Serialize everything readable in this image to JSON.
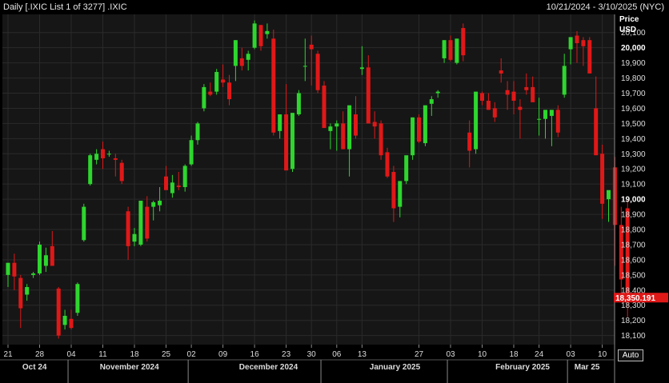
{
  "header": {
    "title": "Daily [.IXIC List 1 of 3277] .IXIC",
    "range": "10/21/2024 - 3/10/2025 (NYC)"
  },
  "auto_label": "Auto",
  "colors": {
    "up": "#2ed62e",
    "down": "#e01818",
    "grid": "#2a2a2a",
    "panel": "#161616",
    "last_bg": "#e01818"
  },
  "chart_data": {
    "type": "candlestick",
    "ylabel": "Price",
    "yunit": "USD",
    "ylim": [
      18040,
      20220
    ],
    "yticks": [
      18100,
      18200,
      18300,
      18400,
      18500,
      18600,
      18700,
      18800,
      18900,
      19000,
      19100,
      19200,
      19300,
      19400,
      19500,
      19600,
      19700,
      19800,
      19900,
      20000,
      20100
    ],
    "ytick_labels": [
      "18,100",
      "18,200",
      "18,300",
      "18,400",
      "18,500",
      "18,600",
      "18,700",
      "18,800",
      "18,900",
      "19,000",
      "19,100",
      "19,200",
      "19,300",
      "19,400",
      "19,500",
      "19,600",
      "19,700",
      "19,800",
      "19,900",
      "20,000",
      "20,100"
    ],
    "major_yticks": [
      19000,
      20000
    ],
    "last_price": 18350.191,
    "last_price_label": "18,350.191",
    "xticks": [
      {
        "idx": 0,
        "label": "21"
      },
      {
        "idx": 5,
        "label": "28"
      },
      {
        "idx": 10,
        "label": "04"
      },
      {
        "idx": 15,
        "label": "11"
      },
      {
        "idx": 20,
        "label": "18"
      },
      {
        "idx": 25,
        "label": "25"
      },
      {
        "idx": 29,
        "label": "02"
      },
      {
        "idx": 34,
        "label": "09"
      },
      {
        "idx": 39,
        "label": "16"
      },
      {
        "idx": 44,
        "label": "23"
      },
      {
        "idx": 48,
        "label": "30"
      },
      {
        "idx": 52,
        "label": "06"
      },
      {
        "idx": 56,
        "label": "13"
      },
      {
        "idx": 65,
        "label": "27"
      },
      {
        "idx": 70,
        "label": "03"
      },
      {
        "idx": 75,
        "label": "10"
      },
      {
        "idx": 80,
        "label": "18"
      },
      {
        "idx": 84,
        "label": "24"
      },
      {
        "idx": 89,
        "label": "03"
      },
      {
        "idx": 94,
        "label": "10"
      }
    ],
    "months": [
      {
        "label": "Oct 24",
        "idx": 4.2
      },
      {
        "label": "November 2024",
        "idx": 19.2
      },
      {
        "label": "December 2024",
        "idx": 41.2
      },
      {
        "label": "January 2025",
        "idx": 61.2
      },
      {
        "label": "February 2025",
        "idx": 81.4
      },
      {
        "label": "Mar 25",
        "idx": 91.6
      }
    ],
    "month_dividers": [
      9.5,
      28.5,
      49.5,
      69.5,
      88.5
    ],
    "candles": [
      [
        18500,
        18580,
        18420,
        18580
      ],
      [
        18580,
        18640,
        18400,
        18490
      ],
      [
        18480,
        18500,
        18150,
        18280
      ],
      [
        18370,
        18440,
        18330,
        18420
      ],
      [
        18500,
        18520,
        18480,
        18510
      ],
      [
        18510,
        18720,
        18500,
        18700
      ],
      [
        18560,
        18680,
        18520,
        18630
      ],
      [
        18690,
        18790,
        18560,
        18560
      ],
      [
        18410,
        18420,
        18080,
        18100
      ],
      [
        18170,
        18270,
        18140,
        18230
      ],
      [
        18210,
        18270,
        18140,
        18150
      ],
      [
        18250,
        18450,
        18230,
        18440
      ],
      [
        18730,
        18970,
        18720,
        18950
      ],
      [
        19100,
        19300,
        19090,
        19290
      ],
      [
        19260,
        19330,
        19230,
        19300
      ],
      [
        19330,
        19380,
        19200,
        19270
      ],
      [
        19300,
        19320,
        19280,
        19300
      ],
      [
        19270,
        19300,
        19150,
        19260
      ],
      [
        19240,
        19260,
        19100,
        19120
      ],
      [
        18920,
        18950,
        18600,
        18690
      ],
      [
        18720,
        18810,
        18690,
        18770
      ],
      [
        18700,
        18990,
        18690,
        18990
      ],
      [
        18950,
        19020,
        18720,
        18740
      ],
      [
        18950,
        18990,
        18860,
        18980
      ],
      [
        18960,
        19080,
        18920,
        18990
      ],
      [
        19150,
        19220,
        19070,
        19060
      ],
      [
        19040,
        19160,
        19010,
        19110
      ],
      [
        19090,
        19180,
        19060,
        19080
      ],
      [
        19080,
        19230,
        19050,
        19220
      ],
      [
        19230,
        19420,
        19220,
        19390
      ],
      [
        19390,
        19510,
        19360,
        19500
      ],
      [
        19600,
        19760,
        19580,
        19740
      ],
      [
        19710,
        19770,
        19680,
        19690
      ],
      [
        19710,
        19860,
        19690,
        19840
      ],
      [
        19790,
        19890,
        19740,
        19770
      ],
      [
        19770,
        19820,
        19620,
        19660
      ],
      [
        19880,
        20050,
        19780,
        20050
      ],
      [
        19930,
        20000,
        19850,
        19880
      ],
      [
        19920,
        19980,
        19850,
        19960
      ],
      [
        20000,
        20180,
        19990,
        20160
      ],
      [
        20150,
        20150,
        19980,
        20010
      ],
      [
        20090,
        20160,
        20060,
        20110
      ],
      [
        20060,
        20120,
        19420,
        19440
      ],
      [
        19450,
        19560,
        19400,
        19560
      ],
      [
        19560,
        19760,
        19500,
        19190
      ],
      [
        19200,
        19250,
        19180,
        19570
      ],
      [
        19560,
        19720,
        19550,
        19700
      ],
      [
        19880,
        20060,
        19780,
        19880
      ],
      [
        20020,
        20080,
        19750,
        19990
      ],
      [
        19960,
        19980,
        19700,
        19720
      ],
      [
        19750,
        19780,
        19600,
        19470
      ],
      [
        19450,
        19500,
        19330,
        19480
      ],
      [
        19480,
        19520,
        19320,
        19500
      ],
      [
        19500,
        19580,
        19430,
        19330
      ],
      [
        19330,
        19440,
        19150,
        19620
      ],
      [
        19560,
        19680,
        19400,
        19420
      ],
      [
        19860,
        20010,
        19820,
        19870
      ],
      [
        19870,
        19950,
        19810,
        19500
      ],
      [
        19510,
        19580,
        19400,
        19480
      ],
      [
        19500,
        19520,
        19260,
        19290
      ],
      [
        19310,
        19340,
        19140,
        19150
      ],
      [
        19180,
        19220,
        18850,
        18940
      ],
      [
        18950,
        19000,
        18880,
        19120
      ],
      [
        19120,
        19280,
        19100,
        19290
      ],
      [
        19290,
        19540,
        19260,
        19540
      ],
      [
        19540,
        19560,
        19370,
        19380
      ],
      [
        19370,
        19600,
        19350,
        19620
      ],
      [
        19630,
        19680,
        19550,
        19660
      ],
      [
        19700,
        19720,
        19670,
        19710
      ],
      [
        19930,
        20050,
        19900,
        20050
      ],
      [
        20050,
        20080,
        19910,
        19920
      ],
      [
        19900,
        20060,
        19890,
        20060
      ],
      [
        20130,
        20160,
        19910,
        19950
      ],
      [
        19440,
        19520,
        19210,
        19320
      ],
      [
        19330,
        19680,
        19300,
        19710
      ],
      [
        19700,
        19710,
        19620,
        19650
      ],
      [
        19650,
        19700,
        19590,
        19590
      ],
      [
        19600,
        19640,
        19510,
        19540
      ],
      [
        19850,
        19930,
        19770,
        19830
      ],
      [
        19720,
        19780,
        19590,
        19690
      ],
      [
        19710,
        19780,
        19560,
        19650
      ],
      [
        19610,
        19660,
        19400,
        19590
      ],
      [
        19740,
        19830,
        19690,
        19720
      ],
      [
        19740,
        19810,
        19670,
        19640
      ],
      [
        19530,
        19670,
        19420,
        19530
      ],
      [
        19530,
        19560,
        19400,
        19590
      ],
      [
        19550,
        19580,
        19350,
        19590
      ],
      [
        19590,
        19620,
        19410,
        19440
      ],
      [
        19690,
        19960,
        19670,
        19880
      ],
      [
        19990,
        20040,
        19890,
        20070
      ],
      [
        20080,
        20110,
        19900,
        20030
      ],
      [
        20050,
        20070,
        19880,
        20010
      ],
      [
        20050,
        20070,
        19840,
        19830
      ],
      [
        19600,
        19810,
        19480,
        19290
      ],
      [
        19300,
        19360,
        18870,
        18970
      ],
      [
        19000,
        19040,
        18850,
        19060
      ],
      [
        19210,
        19280,
        18560,
        18830
      ],
      [
        18830,
        18950,
        18360,
        18470
      ],
      [
        18940,
        19000,
        18220,
        18350
      ]
    ]
  }
}
